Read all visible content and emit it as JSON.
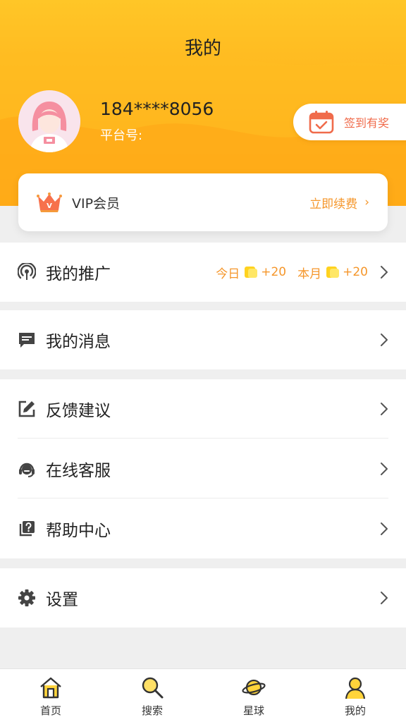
{
  "header": {
    "title": "我的",
    "accent": "#ffb21c"
  },
  "profile": {
    "phone": "184****8056",
    "platform_label": "平台号:",
    "platform_value": ""
  },
  "checkin": {
    "label": "签到有奖"
  },
  "vip": {
    "label": "VIP会员",
    "action": "立即续费",
    "arrow": "›"
  },
  "menu": {
    "promotion": {
      "label": "我的推广",
      "today_label": "今日",
      "today_value": "+20",
      "month_label": "本月",
      "month_value": "+20",
      "icon": "broadcast-icon"
    },
    "messages": {
      "label": "我的消息",
      "icon": "message-icon"
    },
    "feedback": {
      "label": "反馈建议",
      "icon": "edit-icon"
    },
    "service": {
      "label": "在线客服",
      "icon": "headset-icon"
    },
    "help": {
      "label": "帮助中心",
      "icon": "help-icon"
    },
    "settings": {
      "label": "设置",
      "icon": "gear-icon"
    }
  },
  "tabbar": {
    "items": [
      {
        "label": "首页",
        "icon": "home-icon"
      },
      {
        "label": "搜索",
        "icon": "search-icon"
      },
      {
        "label": "星球",
        "icon": "planet-icon"
      },
      {
        "label": "我的",
        "icon": "user-icon"
      }
    ]
  },
  "colors": {
    "orange_text": "#f5962a",
    "checkin_text": "#f06b4b",
    "icon_gray": "#444444"
  }
}
